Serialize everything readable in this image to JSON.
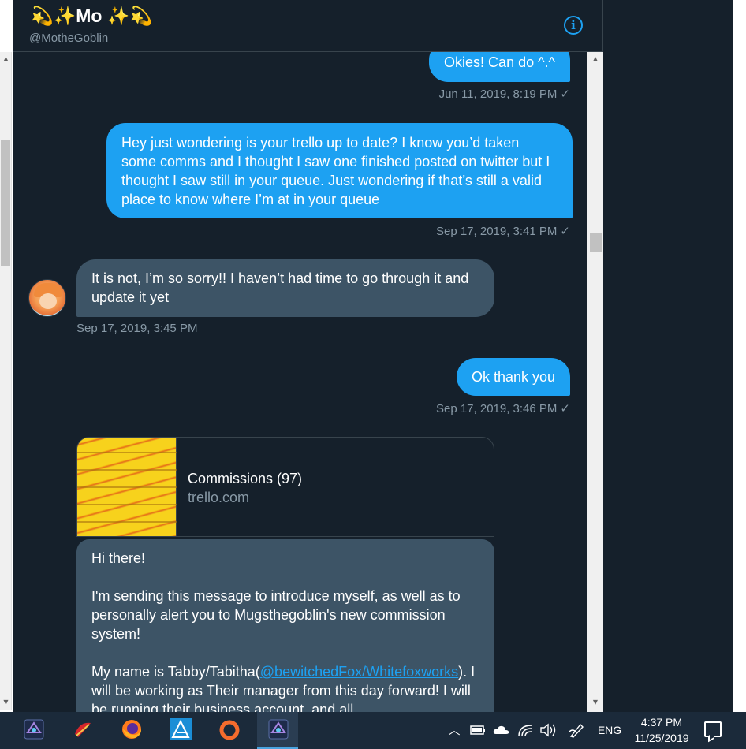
{
  "header": {
    "name": "💫✨Mo ✨💫",
    "handle": "@MotheGoblin",
    "info_icon": "info-icon"
  },
  "messages": [
    {
      "text": "Okies! Can do ^.^",
      "time": "Jun 11, 2019, 8:19 PM",
      "check": "✓"
    },
    {
      "text": "Hey just wondering is your trello up to date? I know you’d taken some comms and I thought I saw one finished posted on twitter but I thought I saw still in your queue. Just wondering if that’s still a valid place to know where I’m at in your queue",
      "time": "Sep 17, 2019, 3:41 PM",
      "check": "✓"
    },
    {
      "text": "It is not, I’m so sorry!! I haven’t had time to go through it and update it yet",
      "time": "Sep 17, 2019, 3:45 PM"
    },
    {
      "text": "Ok thank you",
      "time": "Sep 17, 2019, 3:46 PM",
      "check": "✓"
    }
  ],
  "card": {
    "title": "Commissions (97)",
    "domain": "trello.com"
  },
  "long_message": {
    "p1": "Hi there!",
    "p2": "I'm sending this message to introduce myself, as well as to personally alert you to Mugsthegoblin's new commission system!",
    "p3_before": "My name is Tabby/Tabitha(",
    "p3_link": "@bewitchedFox/Whitefoxworks",
    "p3_after": "). I will be working as Their manager from this day forward! I will be running their business account, and all"
  },
  "taskbar": {
    "apps": [
      "affinity-photo-icon",
      "krita-icon",
      "firefox-icon",
      "affinity-designer-icon",
      "origin-icon",
      "affinity-photo-icon"
    ],
    "language": "ENG",
    "time": "4:37 PM",
    "date": "11/25/2019"
  },
  "colors": {
    "background": "#15202b",
    "outgoing": "#1da1f2",
    "incoming": "#3d5466",
    "secondary_text": "#8899a6"
  }
}
